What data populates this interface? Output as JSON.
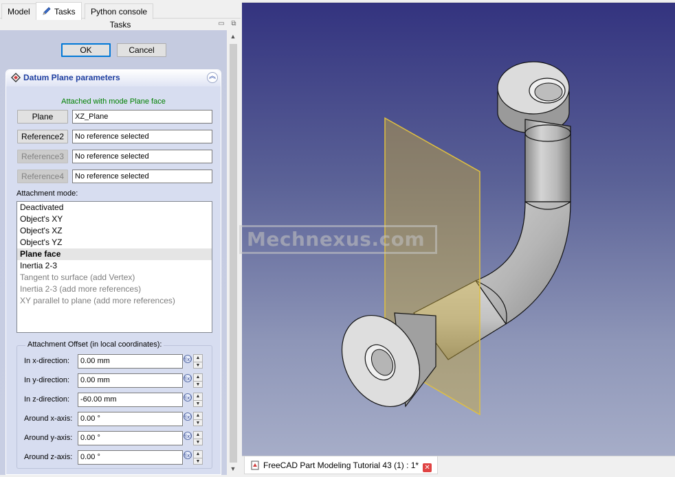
{
  "tabs": [
    {
      "label": "Model"
    },
    {
      "label": "Tasks",
      "active": true
    },
    {
      "label": "Python console"
    }
  ],
  "panel_title": "Tasks",
  "buttons": {
    "ok": "OK",
    "cancel": "Cancel"
  },
  "datum_plane": {
    "title": "Datum Plane parameters",
    "status": "Attached with mode Plane face",
    "references": [
      {
        "button": "Plane",
        "value": "XZ_Plane",
        "enabled": true
      },
      {
        "button": "Reference2",
        "value": "No reference selected",
        "enabled": true
      },
      {
        "button": "Reference3",
        "value": "No reference selected",
        "enabled": false
      },
      {
        "button": "Reference4",
        "value": "No reference selected",
        "enabled": false
      }
    ],
    "attachment_mode_label": "Attachment mode:",
    "modes": [
      {
        "label": "Deactivated",
        "state": "normal"
      },
      {
        "label": "Object's XY",
        "state": "normal"
      },
      {
        "label": "Object's XZ",
        "state": "normal"
      },
      {
        "label": "Object's YZ",
        "state": "normal"
      },
      {
        "label": "Plane face",
        "state": "selected"
      },
      {
        "label": "Inertia 2-3",
        "state": "normal"
      },
      {
        "label": "Tangent to surface (add Vertex)",
        "state": "dim"
      },
      {
        "label": "Inertia 2-3 (add more references)",
        "state": "dim"
      },
      {
        "label": "XY parallel to plane (add more references)",
        "state": "dim"
      }
    ],
    "offset_title": "Attachment Offset (in local coordinates):",
    "offsets": [
      {
        "label": "In x-direction:",
        "value": "0.00 mm"
      },
      {
        "label": "In y-direction:",
        "value": "0.00 mm"
      },
      {
        "label": "In z-direction:",
        "value": "-60.00 mm"
      },
      {
        "label": "Around x-axis:",
        "value": "0.00 °"
      },
      {
        "label": "Around y-axis:",
        "value": "0.00 °"
      },
      {
        "label": "Around z-axis:",
        "value": "0.00 °"
      }
    ]
  },
  "watermark": "Mechnexus.com",
  "document_tab": "FreeCAD Part Modeling Tutorial 43 (1) : 1*",
  "colors": {
    "panel_bg": "#c5cbe0",
    "group_bg": "#d7ddf0",
    "status_green": "#008000",
    "title_blue": "#1f3fa0",
    "datum_plane": "#c8a83a"
  }
}
